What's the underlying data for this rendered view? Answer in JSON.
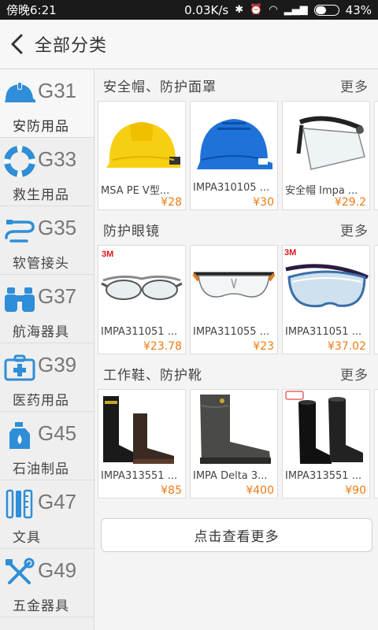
{
  "status": {
    "time": "傍晚6:21",
    "speed": "0.03K/s",
    "battery": "43%",
    "battery_level": 0.43
  },
  "header": {
    "title": "全部分类"
  },
  "sidebar": {
    "items": [
      {
        "code": "G31",
        "name": "安防用品",
        "icon": "helmet-icon"
      },
      {
        "code": "G33",
        "name": "救生用品",
        "icon": "lifebuoy-icon"
      },
      {
        "code": "G35",
        "name": "软管接头",
        "icon": "hose-icon"
      },
      {
        "code": "G37",
        "name": "航海器具",
        "icon": "binoculars-icon"
      },
      {
        "code": "G39",
        "name": "医药用品",
        "icon": "medical-kit-icon"
      },
      {
        "code": "G45",
        "name": "石油制品",
        "icon": "oil-can-icon"
      },
      {
        "code": "G47",
        "name": "文具",
        "icon": "ruler-icon"
      },
      {
        "code": "G49",
        "name": "五金器具",
        "icon": "tools-icon"
      }
    ]
  },
  "sections": [
    {
      "title": "安全帽、防护面罩",
      "more": "更多",
      "products": [
        {
          "name": "MSA PE V型...",
          "price": "¥28"
        },
        {
          "name": "IMPA310105 ...",
          "price": "¥30"
        },
        {
          "name": "安全帽 Impa ...",
          "price": "¥29.2"
        }
      ]
    },
    {
      "title": "防护眼镜",
      "more": "更多",
      "products": [
        {
          "name": "IMPA311051 ...",
          "price": "¥23.78",
          "brand": "3M"
        },
        {
          "name": "IMPA311055 ...",
          "price": "¥23"
        },
        {
          "name": "IMPA311051 ...",
          "price": "¥37.02",
          "brand": "3M"
        }
      ]
    },
    {
      "title": "工作鞋、防护靴",
      "more": "更多",
      "products": [
        {
          "name": "IMPA313551 ...",
          "price": "¥85"
        },
        {
          "name": "IMPA Delta 3...",
          "price": "¥400"
        },
        {
          "name": "IMPA313551 ...",
          "price": "¥90"
        }
      ]
    }
  ],
  "more_button": "点击查看更多",
  "colors": {
    "accent": "#2e8ed7",
    "price": "#f07a14"
  }
}
